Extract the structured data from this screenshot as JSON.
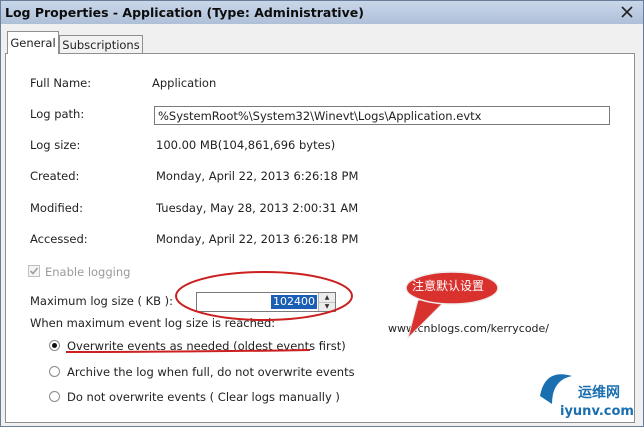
{
  "window": {
    "title": "Log Properties - Application (Type: Administrative)"
  },
  "tabs": [
    {
      "label": "General",
      "active": true
    },
    {
      "label": "Subscriptions",
      "active": false
    }
  ],
  "fields": {
    "full_name_label": "Full Name:",
    "full_name_value": "Application",
    "log_path_label": "Log path:",
    "log_path_value": "%SystemRoot%\\System32\\Winevt\\Logs\\Application.evtx",
    "log_size_label": "Log size:",
    "log_size_value": "100.00 MB(104,861,696 bytes)",
    "created_label": "Created:",
    "created_value": "Monday, April 22, 2013 6:26:18 PM",
    "modified_label": "Modified:",
    "modified_value": "Tuesday, May 28, 2013 2:00:31 AM",
    "accessed_label": "Accessed:",
    "accessed_value": "Monday, April 22, 2013 6:26:18 PM"
  },
  "enable_logging": {
    "label": "Enable logging",
    "checked": true,
    "disabled": true
  },
  "max_size": {
    "label": "Maximum log size ( KB ):",
    "value": "102400"
  },
  "retention": {
    "heading": "When maximum event log size is reached:",
    "options": [
      {
        "label": "Overwrite events as needed (oldest events first)",
        "checked": true
      },
      {
        "label": "Archive the log when full, do not overwrite events",
        "checked": false
      },
      {
        "label": "Do not overwrite events ( Clear logs manually )",
        "checked": false
      }
    ]
  },
  "annotation": {
    "callout_text": "注意默认设置",
    "accent_red": "#cc1f1f",
    "callout_fill": "#d9322e"
  },
  "watermark": {
    "text": "www.cnblogs.com/kerrycode/"
  },
  "logo": {
    "name": "运维网",
    "url": "iyunv.com"
  }
}
